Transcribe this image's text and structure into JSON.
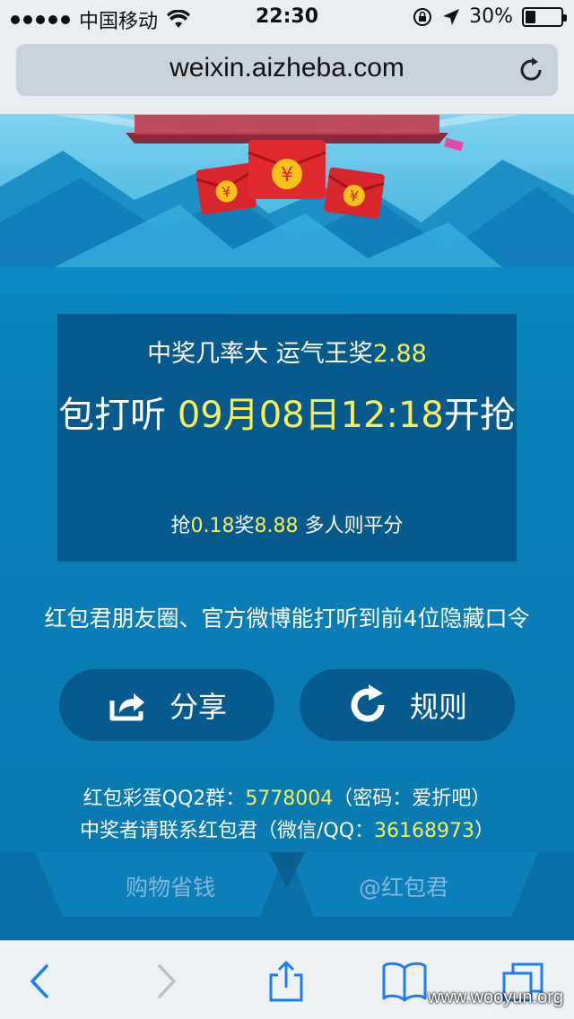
{
  "status_bar": {
    "carrier": "中国移动",
    "time": "22:30",
    "battery_percent": "30%",
    "battery_level": 0.3
  },
  "browser": {
    "url": "weixin.aizheba.com"
  },
  "promo": {
    "line1_prefix": "中奖几率大 运气王奖",
    "line1_value": "2.88",
    "line2_prefix": "包打听 ",
    "line2_time": "09月08日12:18",
    "line2_suffix": "开抢",
    "line3_prefix": "抢",
    "line3_v1": "0.18",
    "line3_mid": "奖",
    "line3_v2": "8.88",
    "line3_suffix": " 多人则平分"
  },
  "notice": "红包君朋友圈、官方微博能打听到前4位隐藏口令",
  "buttons": {
    "share_label": "分享",
    "rules_label": "规则"
  },
  "footer": {
    "qq_prefix": "红包彩蛋QQ2群：",
    "qq_number": "5778004",
    "qq_suffix": "（密码：爱折吧）",
    "contact_prefix": "中奖者请联系红包君（微信/QQ：",
    "contact_number": "36168973",
    "contact_suffix": "）"
  },
  "tabs": {
    "left": "购物省钱",
    "right": "@红包君"
  },
  "watermark": "www.wooyun.org",
  "colors": {
    "background": "#0a7fb8",
    "panel": "#075a8e",
    "highlight": "#f5ee54",
    "red_envelope": "#d9262c"
  },
  "icons": [
    "wifi-icon",
    "location-arrow-icon",
    "rotation-lock-icon",
    "reload-icon",
    "share-icon",
    "refresh-icon",
    "back-icon",
    "forward-icon",
    "share-sheet-icon",
    "bookmarks-icon",
    "tabs-icon"
  ]
}
